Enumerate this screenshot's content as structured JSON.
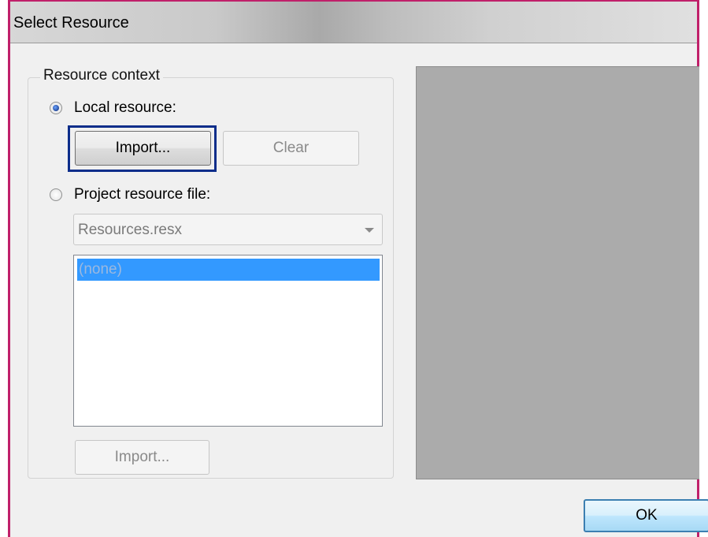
{
  "window": {
    "title": "Select Resource"
  },
  "resource_context": {
    "legend": "Resource context",
    "local_resource": {
      "label": "Local resource:",
      "checked": true
    },
    "import_button": "Import...",
    "clear_button": "Clear",
    "project_resource": {
      "label": "Project resource file:",
      "checked": false
    },
    "file_select": {
      "value": "Resources.resx"
    },
    "resource_list": {
      "items": [
        "(none)"
      ],
      "selected_index": 0
    },
    "project_import_button": "Import..."
  },
  "footer": {
    "ok_button": "OK"
  },
  "icons": [
    "radio-checked-icon",
    "radio-unchecked-icon",
    "dropdown-arrow-icon"
  ],
  "colors": {
    "selection": "#3399ff",
    "focus_ring": "#0c2d8a",
    "preview_background": "#ababab",
    "window_border": "#c0206a"
  }
}
